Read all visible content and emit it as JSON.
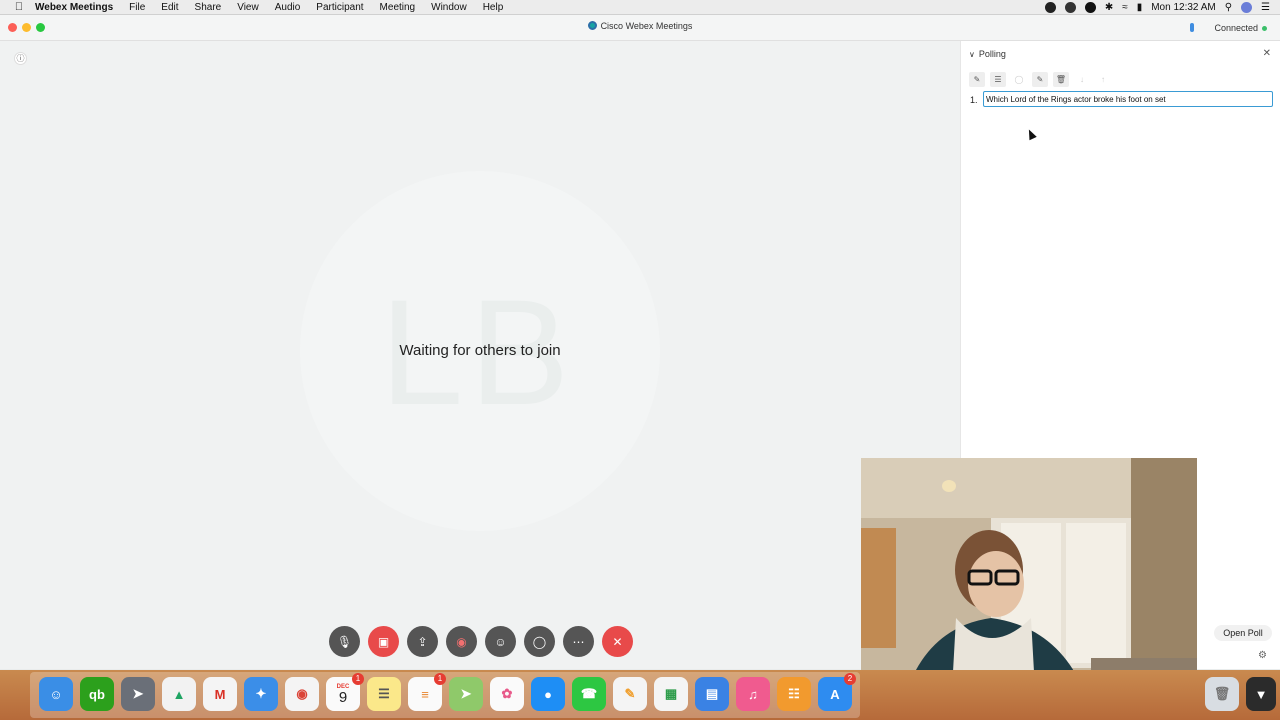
{
  "menubar": {
    "app_name": "Webex Meetings",
    "items": [
      "File",
      "Edit",
      "Share",
      "View",
      "Audio",
      "Participant",
      "Meeting",
      "Window",
      "Help"
    ],
    "clock": "Mon 12:32 AM"
  },
  "window": {
    "title": "Cisco Webex Meetings",
    "connection_status": "Connected"
  },
  "stage": {
    "initials": "LB",
    "waiting_text": "Waiting for others to join"
  },
  "controls": [
    {
      "name": "mute",
      "icon": "mic-off-icon"
    },
    {
      "name": "video",
      "icon": "video-off-icon"
    },
    {
      "name": "share",
      "icon": "share-icon"
    },
    {
      "name": "record",
      "icon": "record-icon"
    },
    {
      "name": "participants",
      "icon": "participants-icon"
    },
    {
      "name": "chat",
      "icon": "chat-icon"
    },
    {
      "name": "more",
      "icon": "more-icon"
    },
    {
      "name": "leave",
      "icon": "close-icon"
    }
  ],
  "polling": {
    "title": "Polling",
    "question_number": "1.",
    "question_text": "Which Lord of the Rings actor broke his foot on set",
    "open_poll_label": "Open Poll"
  },
  "dock": {
    "calendar_month": "DEC",
    "calendar_day": "9",
    "badges": {
      "calendar": "1",
      "reminders": "1",
      "appstore": "2"
    }
  },
  "colors": {
    "leave_red": "#e84a4a",
    "control_gray": "#555555",
    "input_focus": "#3a9bd4",
    "connected_green": "#3bbf6a"
  }
}
